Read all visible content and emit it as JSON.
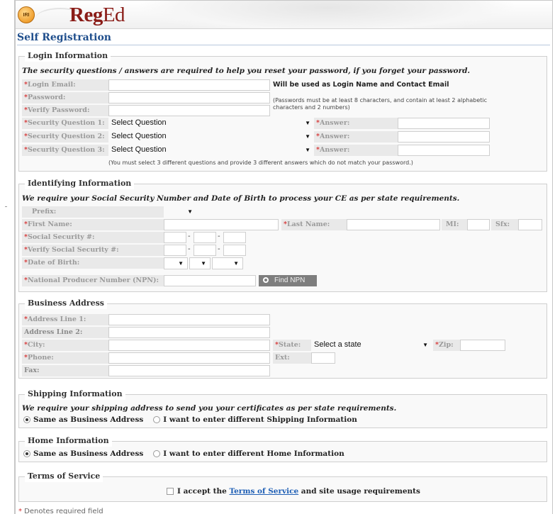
{
  "brand": {
    "badge": "IRI",
    "name_bold": "Reg",
    "name_rest": "Ed"
  },
  "page_title": "Self Registration",
  "login": {
    "legend": "Login Information",
    "note": "The security questions / answers are required to help you reset your password, if you forget your password.",
    "email_label": "Login Email:",
    "email_note": "Will be used as Login Name and Contact Email",
    "password_label": "Password:",
    "verify_label": "Verify Password:",
    "password_rule": "(Passwords must be at least 8 characters, and contain at least 2 alphabetic characters and 2 numbers)",
    "questions": [
      {
        "label": "Security Question 1:",
        "value": "Select Question",
        "answer_label": "Answer:"
      },
      {
        "label": "Security Question 2:",
        "value": "Select Question",
        "answer_label": "Answer:"
      },
      {
        "label": "Security Question 3:",
        "value": "Select Question",
        "answer_label": "Answer:"
      }
    ],
    "questions_note": "(You must select 3 different questions and provide 3 different answers which do not match your password.)"
  },
  "identifying": {
    "legend": "Identifying Information",
    "note": "We require your Social Security Number and Date of Birth to process your CE as per state requirements.",
    "prefix_label": "Prefix:",
    "first_label": "First Name:",
    "last_label": "Last Name:",
    "mi_label": "MI:",
    "sfx_label": "Sfx:",
    "ssn_label": "Social Security #:",
    "verify_ssn_label": "Verify Social Security #:",
    "dob_label": "Date of Birth:",
    "npn_label": "National Producer Number (NPN):",
    "find_npn": "Find NPN",
    "dash": "-"
  },
  "business": {
    "legend": "Business Address",
    "addr1_label": "Address Line 1:",
    "addr2_label": "Address Line 2:",
    "city_label": "City:",
    "state_label": "State:",
    "state_value": "Select a state",
    "zip_label": "Zip:",
    "phone_label": "Phone:",
    "ext_label": "Ext:",
    "fax_label": "Fax:"
  },
  "shipping": {
    "legend": "Shipping Information",
    "note": "We require your shipping address to send you your certificates as per state requirements.",
    "opt_same": "Same as Business Address",
    "opt_diff": "I want to enter different Shipping Information"
  },
  "home": {
    "legend": "Home Information",
    "opt_same": "Same as Business Address",
    "opt_diff": "I want to enter different Home Information"
  },
  "terms": {
    "legend": "Terms of Service",
    "prefix": "I accept the ",
    "link": "Terms of Service",
    "suffix": " and site usage requirements"
  },
  "footnote": {
    "star": "*",
    "text": " Denotes required field"
  },
  "required_mark": "*",
  "arrow": "▼"
}
